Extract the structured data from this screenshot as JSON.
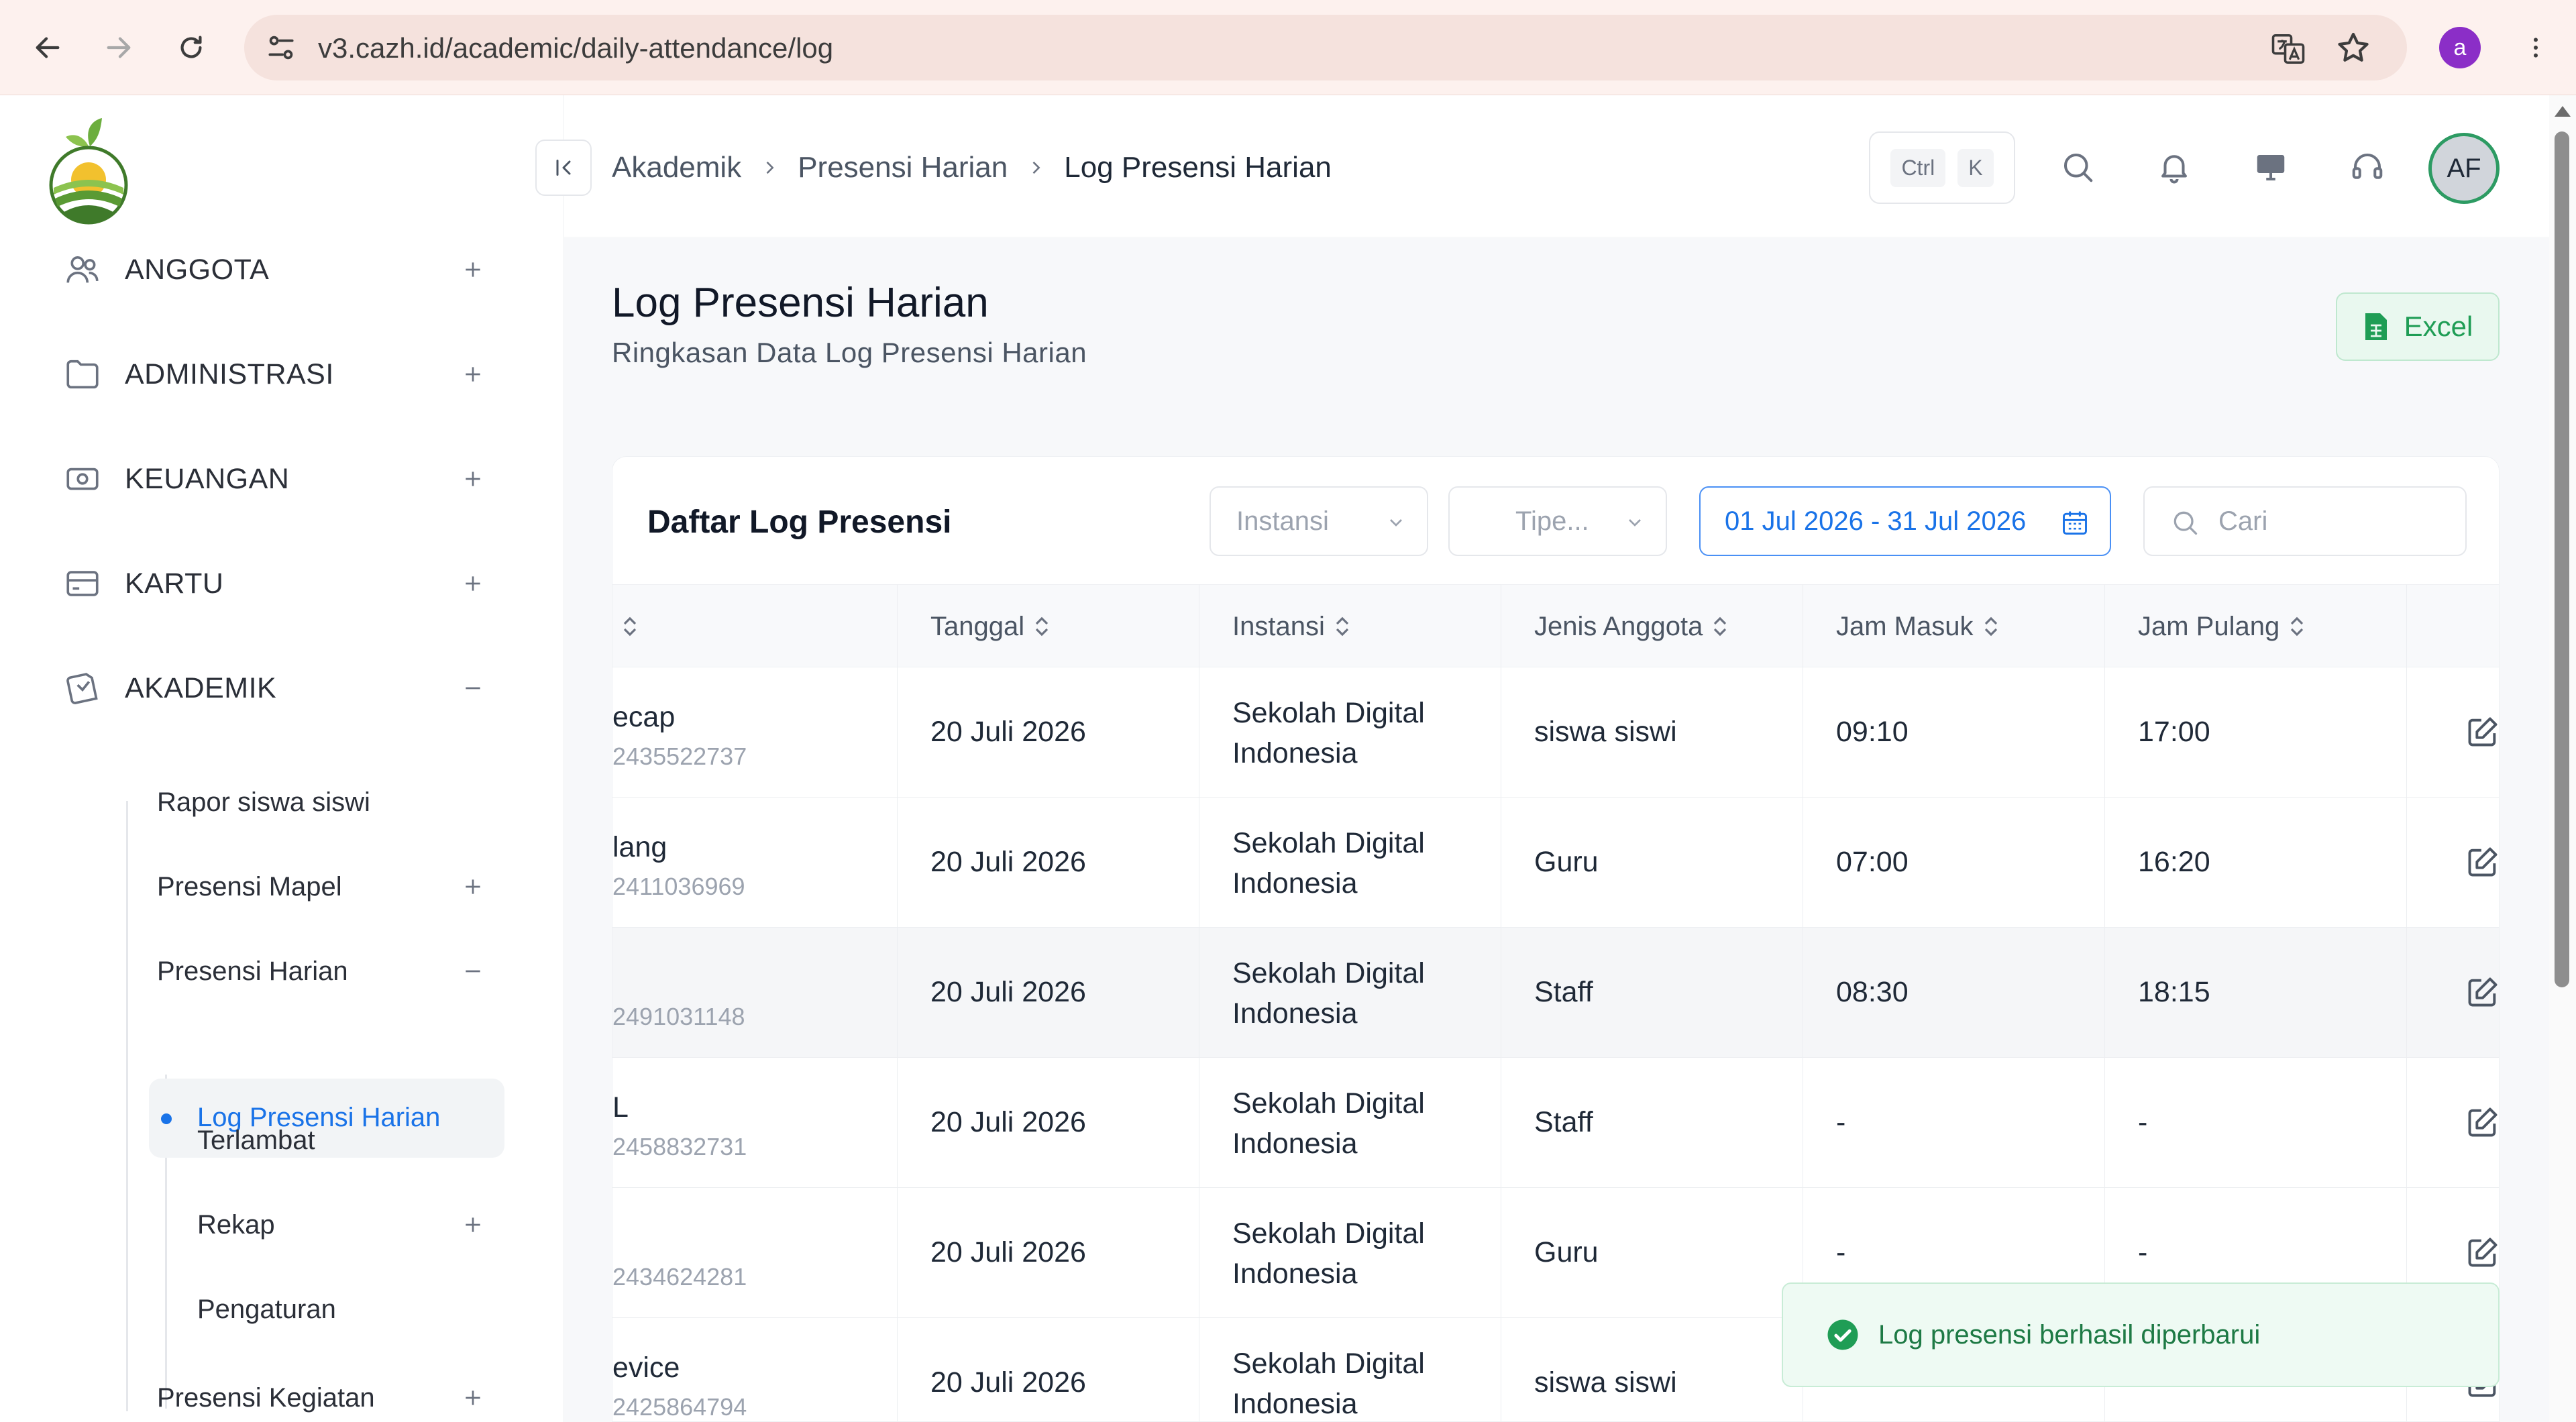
{
  "browser": {
    "url": "v3.cazh.id/academic/daily-attendance/log",
    "profile_initial": "a"
  },
  "sidebar": {
    "menus": [
      {
        "label": "ANGGOTA",
        "icon": "users-icon",
        "toggle": "+"
      },
      {
        "label": "ADMINISTRASI",
        "icon": "folder-icon",
        "toggle": "+"
      },
      {
        "label": "KEUANGAN",
        "icon": "money-icon",
        "toggle": "+"
      },
      {
        "label": "KARTU",
        "icon": "card-icon",
        "toggle": "+"
      },
      {
        "label": "AKADEMIK",
        "icon": "academic-icon",
        "toggle": "–"
      }
    ],
    "sub_items": [
      {
        "label": "Rapor siswa siswi"
      },
      {
        "label": "Presensi Mapel"
      },
      {
        "label": "Presensi Harian"
      },
      {
        "label": "Log Presensi Harian"
      },
      {
        "label": "Terlambat"
      },
      {
        "label": "Rekap"
      },
      {
        "label": "Pengaturan"
      },
      {
        "label": "Presensi Kegiatan"
      }
    ]
  },
  "header": {
    "breadcrumb": [
      "Akademik",
      "Presensi Harian",
      "Log Presensi Harian"
    ],
    "kbd": [
      "Ctrl",
      "K"
    ],
    "avatar": "AF"
  },
  "page": {
    "title": "Log Presensi Harian",
    "subtitle": "Ringkasan Data Log Presensi Harian",
    "excel_label": "Excel"
  },
  "card": {
    "title": "Daftar Log Presensi",
    "filters": {
      "instansi": "Instansi",
      "tipe": "Tipe...",
      "date_range": "01 Jul 2026 - 31 Jul 2026",
      "search_placeholder": "Cari"
    },
    "columns": [
      "Tanggal",
      "Instansi",
      "Jenis Anggota",
      "Jam Masuk",
      "Jam Pulang"
    ],
    "rows": [
      {
        "name": "ecap",
        "id": "2435522737",
        "date": "20 Juli 2026",
        "inst1": "Sekolah Digital",
        "inst2": "Indonesia",
        "type": "siswa siswi",
        "in": "09:10",
        "out": "17:00"
      },
      {
        "name": "lang",
        "id": "2411036969",
        "date": "20 Juli 2026",
        "inst1": "Sekolah Digital",
        "inst2": "Indonesia",
        "type": "Guru",
        "in": "07:00",
        "out": "16:20"
      },
      {
        "name": "",
        "id": "2491031148",
        "date": "20 Juli 2026",
        "inst1": "Sekolah Digital",
        "inst2": "Indonesia",
        "type": "Staff",
        "in": "08:30",
        "out": "18:15"
      },
      {
        "name": "L",
        "id": "2458832731",
        "date": "20 Juli 2026",
        "inst1": "Sekolah Digital",
        "inst2": "Indonesia",
        "type": "Staff",
        "in": "-",
        "out": "-"
      },
      {
        "name": "",
        "id": "2434624281",
        "date": "20 Juli 2026",
        "inst1": "Sekolah Digital",
        "inst2": "Indonesia",
        "type": "Guru",
        "in": "-",
        "out": "-"
      },
      {
        "name": "evice",
        "id": "2425864794",
        "date": "20 Juli 2026",
        "inst1": "Sekolah Digital",
        "inst2": "Indonesia",
        "type": "siswa siswi",
        "in": "",
        "out": ""
      }
    ]
  },
  "toast": {
    "message": "Log presensi berhasil diperbarui"
  },
  "colors": {
    "accent": "#1a73e8",
    "success": "#1f9d55",
    "chrome": "#fdf1ee"
  }
}
